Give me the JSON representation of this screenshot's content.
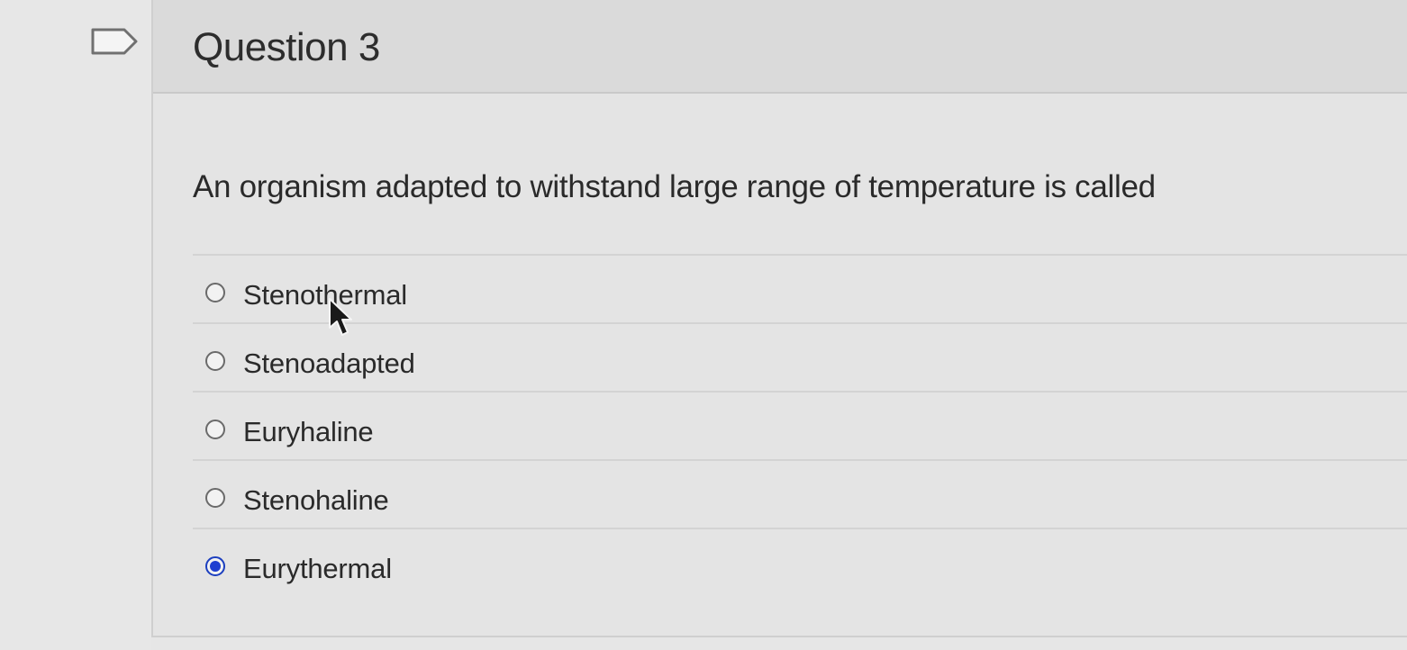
{
  "question": {
    "title": "Question 3",
    "prompt": "An organism adapted to withstand large range of temperature is called",
    "answers": [
      {
        "label": "Stenothermal",
        "selected": false
      },
      {
        "label": "Stenoadapted",
        "selected": false
      },
      {
        "label": "Euryhaline",
        "selected": false
      },
      {
        "label": "Stenohaline",
        "selected": false
      },
      {
        "label": "Eurythermal",
        "selected": true
      }
    ]
  },
  "icons": {
    "flag": "flag-icon",
    "cursor": "cursor-arrow-icon",
    "radio_selected_color": "#1f3fd0"
  }
}
